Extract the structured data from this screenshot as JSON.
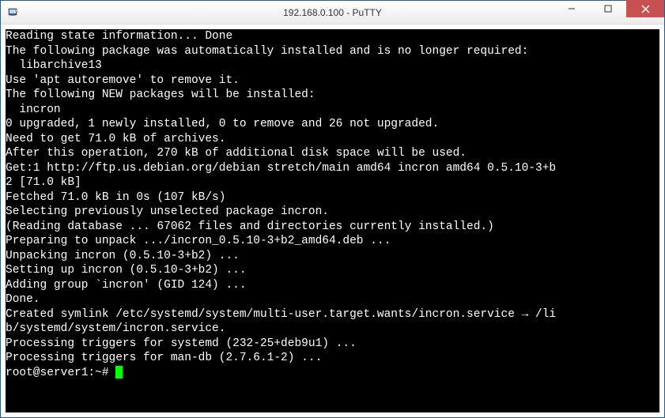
{
  "window": {
    "title": "192.168.0.100 - PuTTY"
  },
  "terminal": {
    "lines": [
      "Reading state information... Done",
      "The following package was automatically installed and is no longer required:",
      "  libarchive13",
      "Use 'apt autoremove' to remove it.",
      "The following NEW packages will be installed:",
      "  incron",
      "0 upgraded, 1 newly installed, 0 to remove and 26 not upgraded.",
      "Need to get 71.0 kB of archives.",
      "After this operation, 270 kB of additional disk space will be used.",
      "Get:1 http://ftp.us.debian.org/debian stretch/main amd64 incron amd64 0.5.10-3+b",
      "2 [71.0 kB]",
      "Fetched 71.0 kB in 0s (107 kB/s)",
      "Selecting previously unselected package incron.",
      "(Reading database ... 67062 files and directories currently installed.)",
      "Preparing to unpack .../incron_0.5.10-3+b2_amd64.deb ...",
      "Unpacking incron (0.5.10-3+b2) ...",
      "Setting up incron (0.5.10-3+b2) ...",
      "Adding group `incron' (GID 124) ...",
      "Done.",
      "Created symlink /etc/systemd/system/multi-user.target.wants/incron.service → /li",
      "b/systemd/system/incron.service.",
      "Processing triggers for systemd (232-25+deb9u1) ...",
      "Processing triggers for man-db (2.7.6.1-2) ..."
    ],
    "prompt": "root@server1:~# "
  }
}
